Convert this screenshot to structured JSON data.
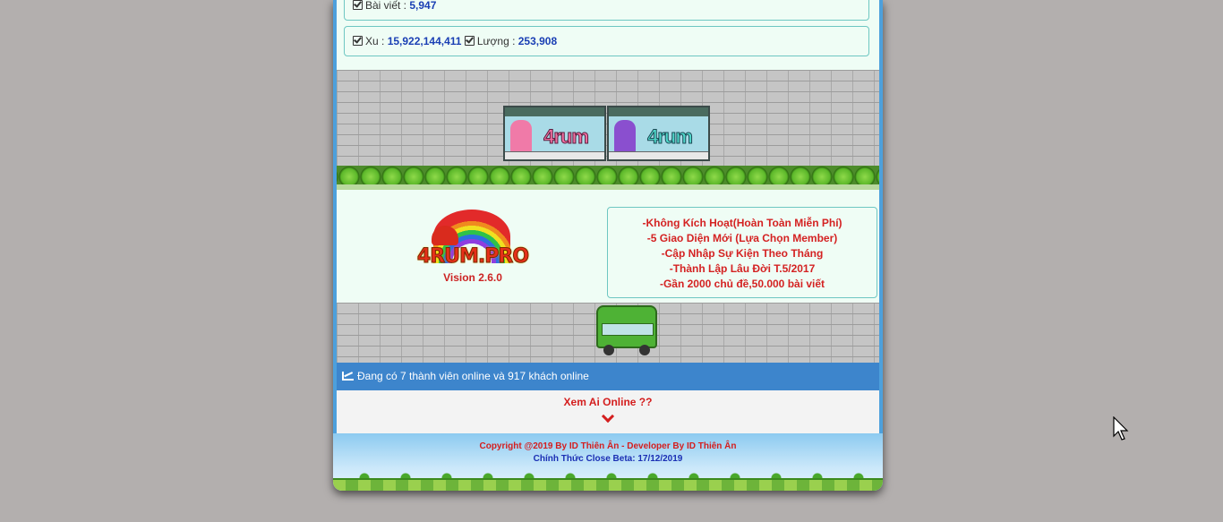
{
  "stats": {
    "posts_label": "Bài viết :",
    "posts_value": "5,947",
    "xu_label": "Xu :",
    "xu_value": "15,922,144,411",
    "luong_label": "Lượng :",
    "luong_value": "253,908"
  },
  "banner": {
    "sign_left": "4rum",
    "sign_right": "4rum"
  },
  "logo": {
    "text": "4RUM.PRO",
    "version": "Vision 2.6.0"
  },
  "features": [
    "-Không Kích Hoạt(Hoàn Toàn Miễn Phí)",
    "-5 Giao Diện Mới (Lựa Chọn Member)",
    "-Cập Nhập Sự Kiện Theo Tháng",
    "-Thành Lập Lâu Đời T.5/2017",
    "-Gần 2000 chủ đề,50.000 bài viết"
  ],
  "online": {
    "text": "Đang có 7 thành viên online và 917 khách online",
    "who_link": "Xem Ai Online ??"
  },
  "footer": {
    "copyright": "Copyright @2019 By ID Thiên Ân - Developer By ID Thiên Ân",
    "beta": "Chính Thức Close Beta: 17/12/2019"
  },
  "colors": {
    "page_bg": "#b3afae",
    "frame": "#4da0dc",
    "panel": "#effdf5",
    "accent_red": "#d41e1e",
    "value_blue": "#1a3fb4",
    "online_bar": "#3d85cc"
  }
}
